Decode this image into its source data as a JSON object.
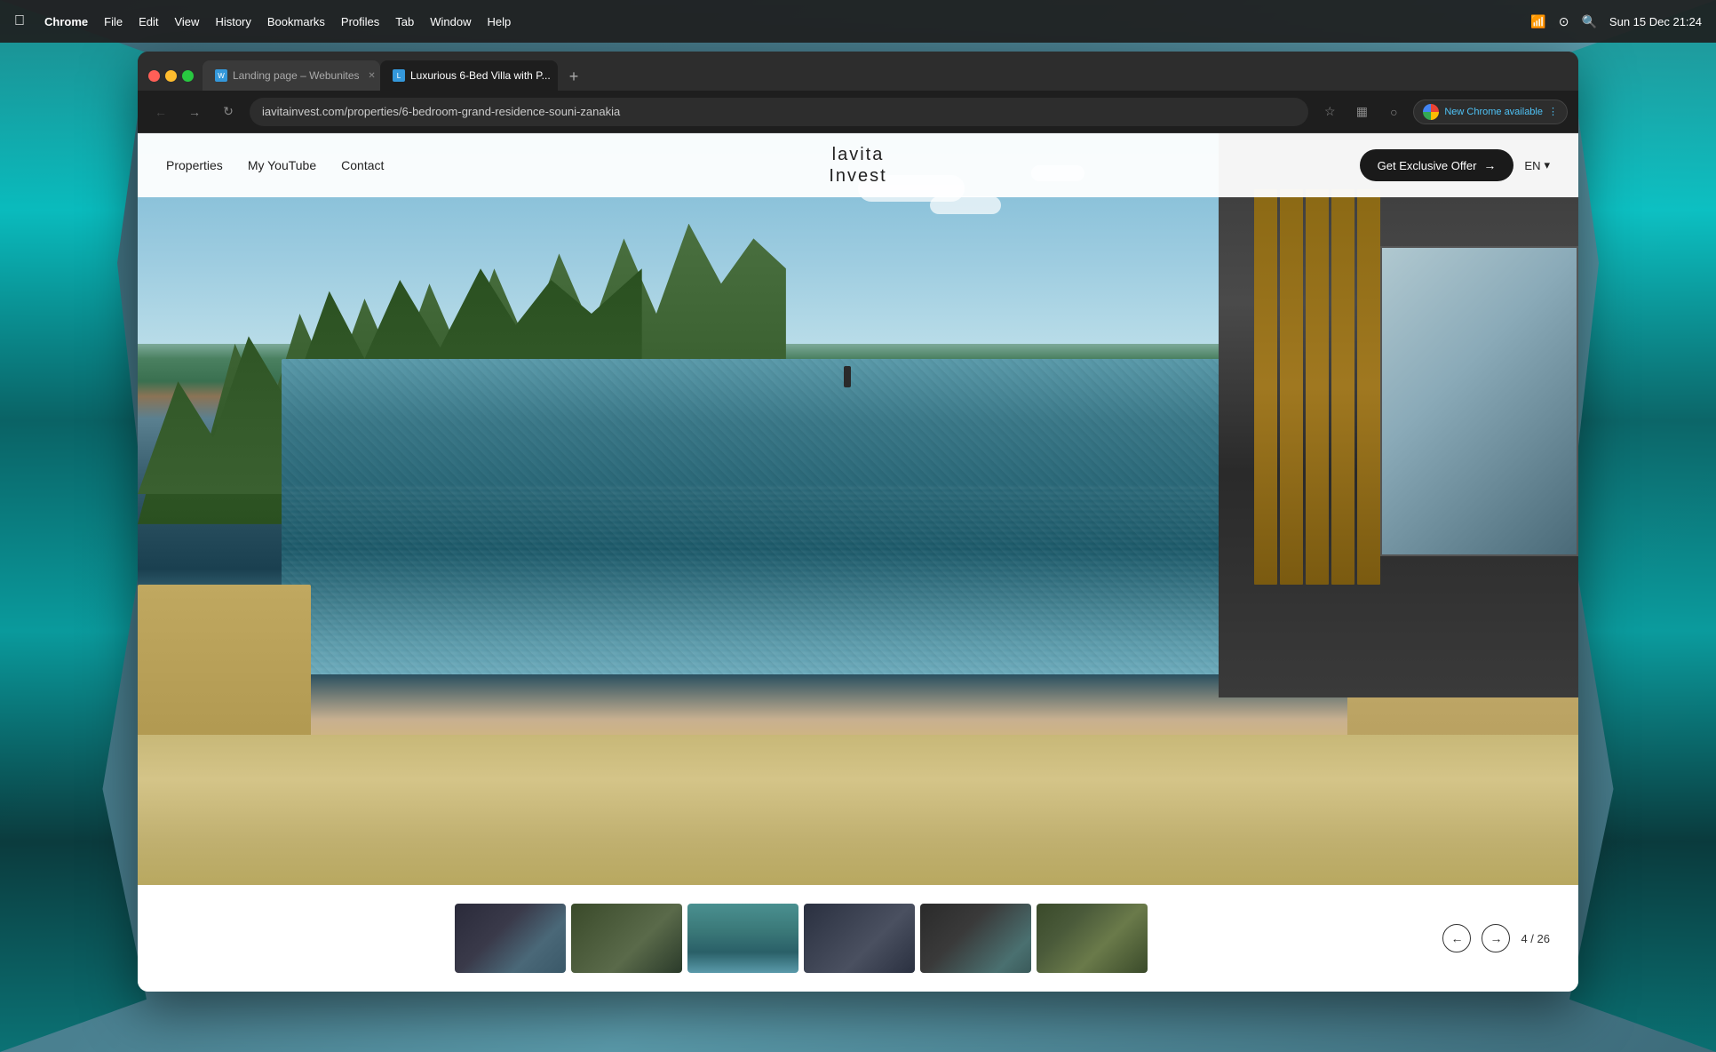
{
  "desktop": {
    "background_color": "#4a7a8a"
  },
  "menubar": {
    "apple_label": "",
    "app_name": "Chrome",
    "menus": [
      "File",
      "Edit",
      "View",
      "History",
      "Bookmarks",
      "Profiles",
      "Tab",
      "Window",
      "Help"
    ],
    "time": "Sun 15 Dec  21:24"
  },
  "browser": {
    "tabs": [
      {
        "label": "Landing page – Webunites",
        "active": false,
        "favicon": "W"
      },
      {
        "label": "Luxurious 6-Bed Villa with P...",
        "active": true,
        "favicon": "L"
      }
    ],
    "address": "iavitainvest.com/properties/6-bedroom-grand-residence-souni-zanakia",
    "chrome_update_label": "New Chrome available"
  },
  "website": {
    "nav": {
      "links": [
        "Properties",
        "My YouTube",
        "Contact"
      ],
      "logo_line1": "lavita",
      "logo_line2": "Invest",
      "cta_button": "Get Exclusive Offer",
      "cta_arrow": "→",
      "language": "EN",
      "language_arrow": "▾"
    },
    "gallery": {
      "current": 4,
      "total": 26,
      "nav_prev": "←",
      "nav_next": "→",
      "counter_label": "4 / 26"
    }
  }
}
